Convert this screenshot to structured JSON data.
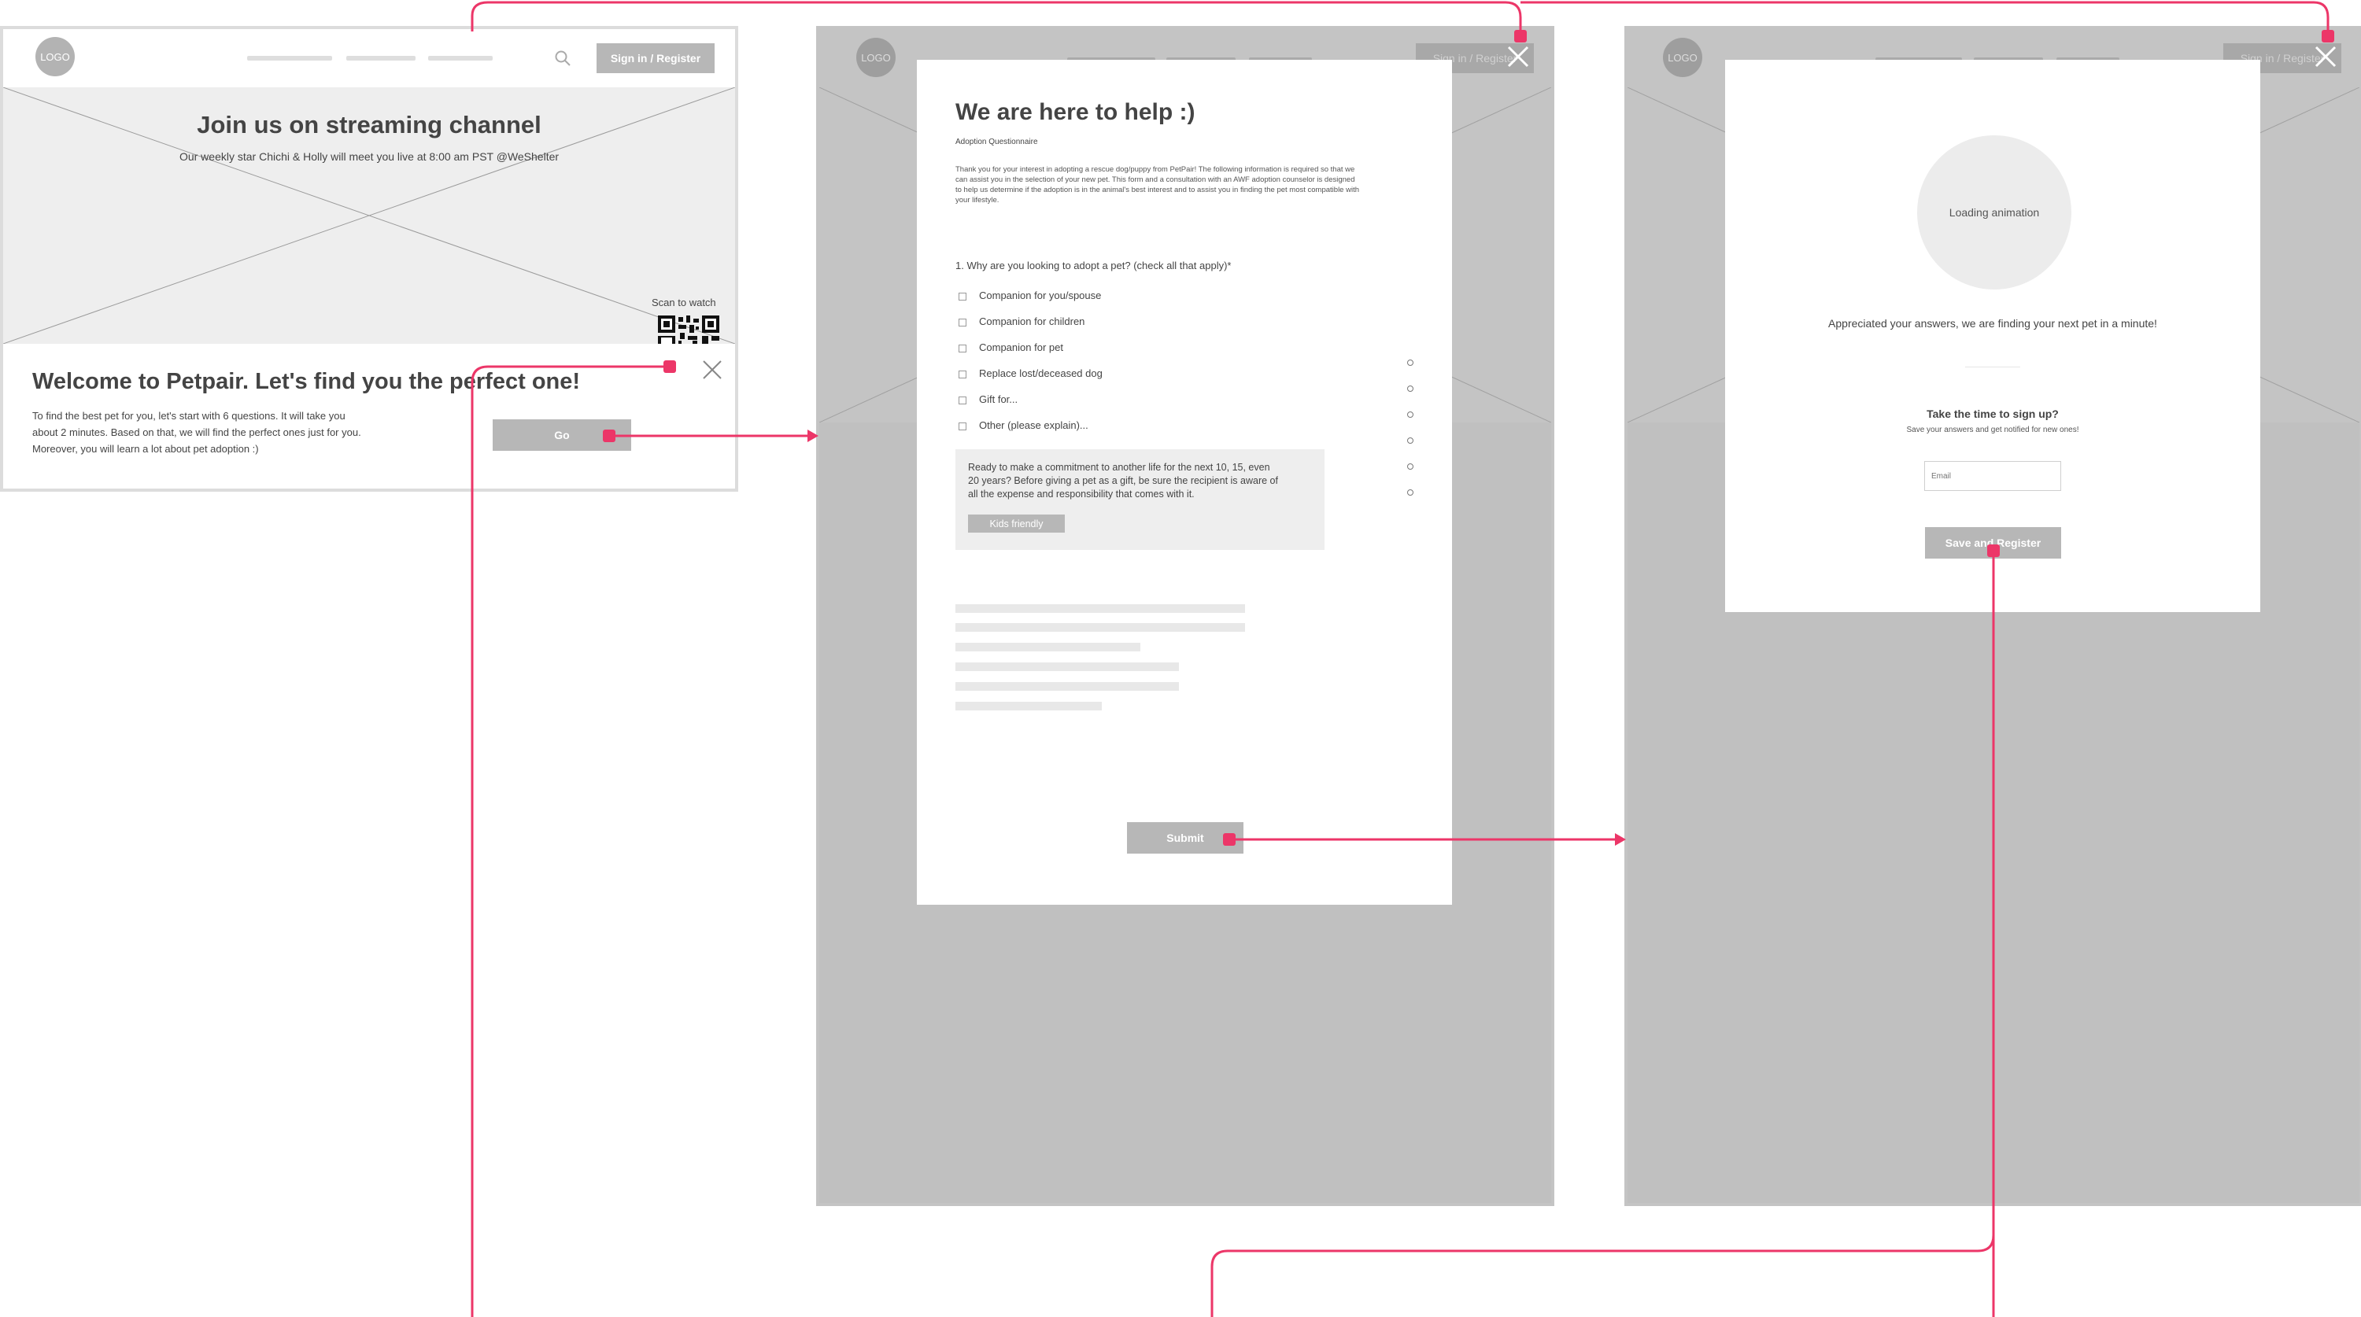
{
  "screen1": {
    "logo": "LOGO",
    "signin_label": "Sign in / Register",
    "hero_title": "Join us on streaming channel",
    "hero_subtitle": "Our weekly star Chichi & Holly will meet you live at 8:00 am PST @WeShelter",
    "scan_label": "Scan to watch",
    "welcome_title": "Welcome to Petpair. Let's find you the perfect one!",
    "welcome_body": [
      "To find the best pet for you, let's start with 6 questions. It will take you",
      "about 2 minutes. Based on that, we will find the perfect ones just for you.",
      "Moreover, you will learn a lot about pet adoption :)"
    ],
    "go_label": "Go"
  },
  "screen2": {
    "logo": "LOGO",
    "signin_label": "Sign in / Register",
    "title": "We are here to help :)",
    "subtitle": "Adoption Questionnaire",
    "intro": [
      "Thank you for your interest in adopting a rescue dog/puppy from PetPair! The following information is required so that we",
      "can assist you in the selection of your new pet. This form and a consultation with an AWF adoption counselor is designed",
      "to help us determine if the adoption is in the animal's best interest and to assist you in finding the pet most compatible with",
      "your lifestyle."
    ],
    "question": "1. Why are you looking to adopt a pet? (check all that apply)*",
    "options": [
      "Companion for you/spouse",
      "Companion for children",
      "Companion for pet",
      "Replace lost/deceased dog",
      "Gift for...",
      "Other (please explain)..."
    ],
    "tip_text": [
      "Ready to make a commitment to another life for the next 10, 15, even",
      "20 years? Before giving a pet as a gift, be sure the recipient is aware of",
      "all the expense and responsibility that comes with it."
    ],
    "tip_tag": "Kids friendly",
    "submit_label": "Submit"
  },
  "screen3": {
    "logo": "LOGO",
    "signin_label": "Sign in / Register",
    "loading_label": "Loading animation",
    "appreciation": "Appreciated your answers, we are finding your next pet in a minute!",
    "signup_title": "Take the time to sign up?",
    "signup_sub": "Save your answers and get notified for new ones!",
    "email_placeholder": "Email",
    "register_label": "Save and Register"
  },
  "colors": {
    "connector": "#ec3668",
    "overlay": "#c0c0c0",
    "button": "#b7b7b7"
  },
  "icons": [
    "search-icon",
    "close-icon",
    "qr-code-icon",
    "checkbox-icon",
    "radio-icon"
  ]
}
